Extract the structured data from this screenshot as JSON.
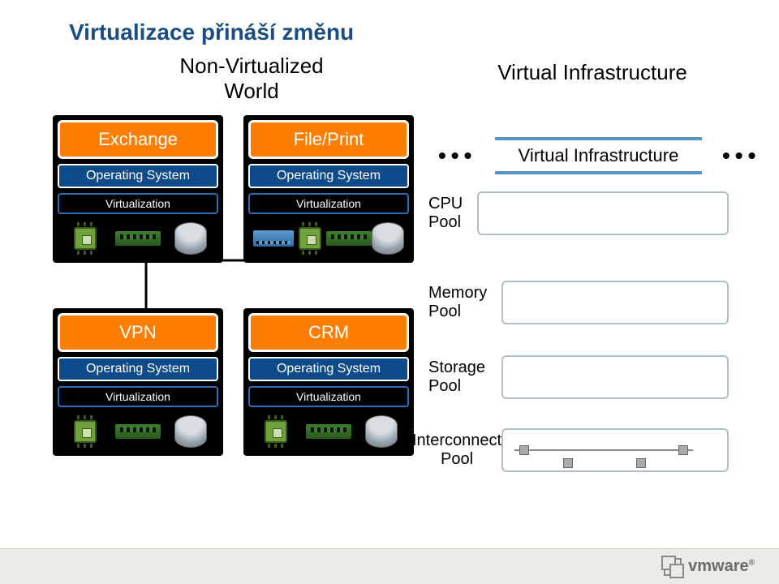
{
  "title": "Virtualizace přináší změnu",
  "subtitles": {
    "left": "Non-Virtualized\nWorld",
    "right": "Virtual Infrastructure"
  },
  "stacks": {
    "a": {
      "app": "Exchange",
      "os": "Operating System",
      "virt": "Virtualization"
    },
    "b": {
      "app": "File/Print",
      "os": "Operating System",
      "virt": "Virtualization"
    },
    "c": {
      "app": "VPN",
      "os": "Operating System",
      "virt": "Virtualization"
    },
    "d": {
      "app": "CRM",
      "os": "Operating System",
      "virt": "Virtualization"
    }
  },
  "vi_label": "Virtual Infrastructure",
  "pools": {
    "cpu": "CPU\nPool",
    "memory": "Memory\nPool",
    "storage": "Storage\nPool",
    "net": "Interconnect\nPool"
  },
  "footer_brand": "vmware"
}
